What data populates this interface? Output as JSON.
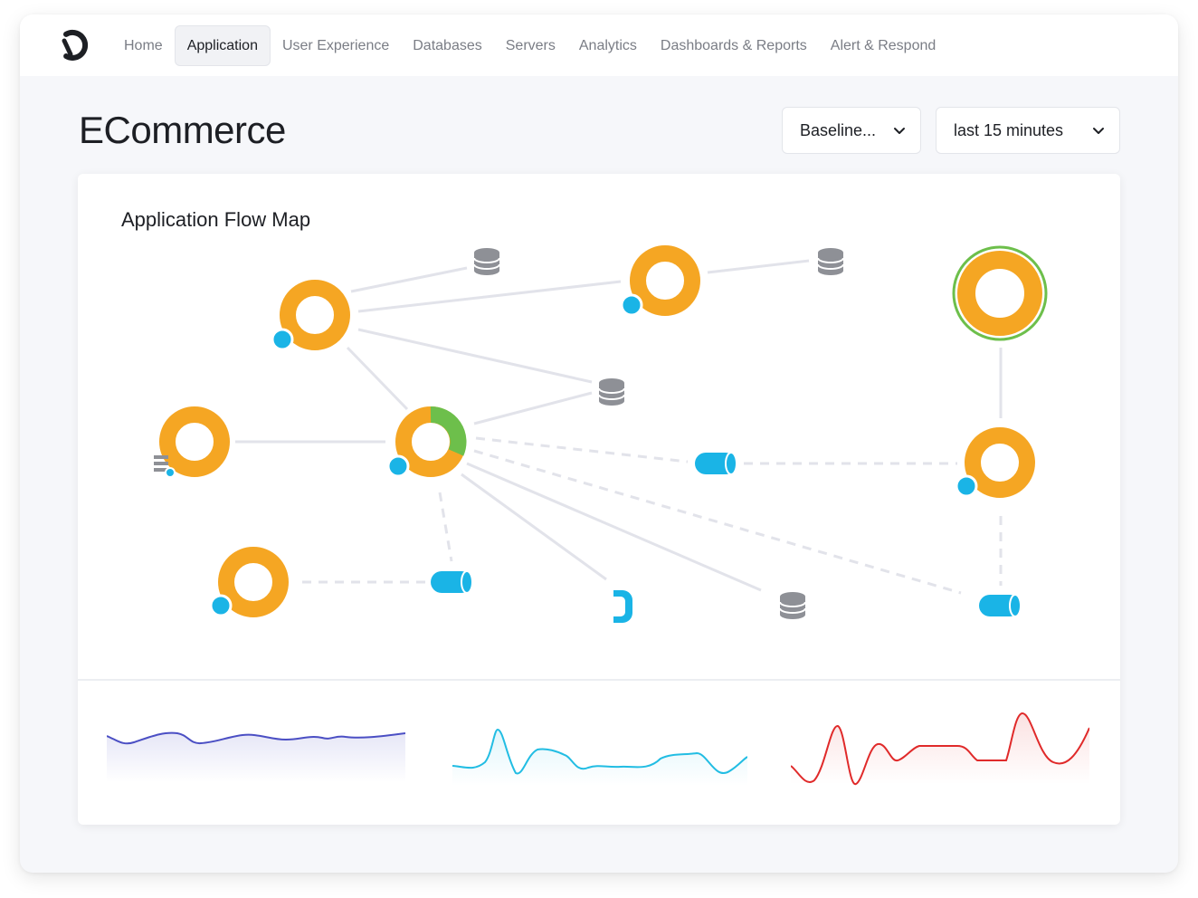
{
  "nav": {
    "items": [
      "Home",
      "Application",
      "User Experience",
      "Databases",
      "Servers",
      "Analytics",
      "Dashboards & Reports",
      "Alert & Respond"
    ],
    "active": "Application"
  },
  "page": {
    "title": "ECommerce"
  },
  "filters": {
    "baseline": "Baseline...",
    "time_range": "last 15 minutes"
  },
  "flow_map": {
    "title": "Application Flow Map"
  },
  "colors": {
    "accent_orange": "#f5a623",
    "healthy_green": "#6dbf4b",
    "tier_blue": "#1ab4e6",
    "db_gray": "#8e9096",
    "spark_purple": "#4b4fc4",
    "spark_cyan": "#22bde3",
    "spark_red": "#e02a2a"
  }
}
